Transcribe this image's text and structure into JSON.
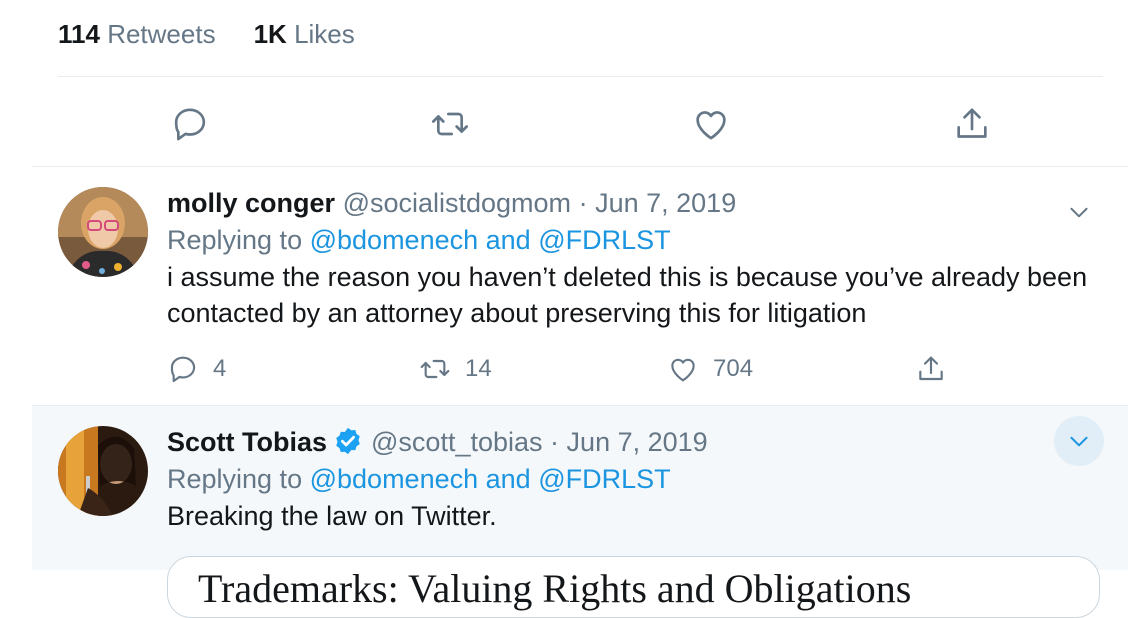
{
  "stats": {
    "retweets_count": "114",
    "retweets_label": "Retweets",
    "likes_count": "1K",
    "likes_label": "Likes"
  },
  "main_actions": [
    "reply-icon",
    "retweet-icon",
    "like-icon",
    "share-icon"
  ],
  "tweets": [
    {
      "name": "molly conger",
      "handle": "@socialistdogmom",
      "separator": "·",
      "date": "Jun 7, 2019",
      "replying_prefix": "Replying to",
      "mention1": "@bdomenech",
      "and": "and",
      "mention2": "@FDRLST",
      "text": "i assume the reason you haven’t deleted this is because you’ve already been contacted by an attorney about preserving this for litigation",
      "replies": "4",
      "retweets": "14",
      "likes": "704"
    },
    {
      "name": "Scott Tobias",
      "verified": true,
      "handle": "@scott_tobias",
      "separator": "·",
      "date": "Jun 7, 2019",
      "replying_prefix": "Replying to",
      "mention1": "@bdomenech",
      "and": "and",
      "mention2": "@FDRLST",
      "text": "Breaking the law on Twitter.",
      "card_title": "Trademarks: Valuing Rights and Obligations"
    }
  ],
  "colors": {
    "accent": "#1b95e0",
    "muted": "#657786",
    "text": "#14171a",
    "hover_bg": "#f5f8fa"
  }
}
